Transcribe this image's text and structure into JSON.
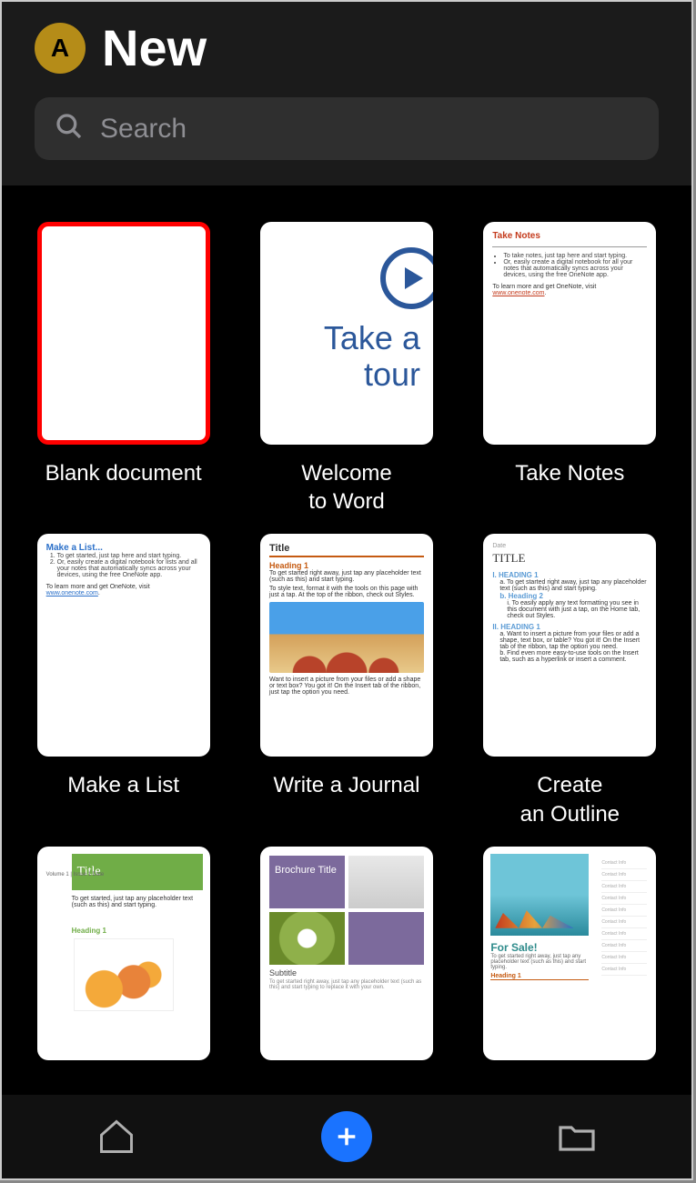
{
  "header": {
    "avatar_letter": "A",
    "title": "New"
  },
  "search": {
    "placeholder": "Search"
  },
  "templates": [
    {
      "label": "Blank document",
      "selected": true,
      "kind": "blank"
    },
    {
      "label": "Welcome\nto Word",
      "kind": "welcome",
      "tour_text": "Take a tour"
    },
    {
      "label": "Take Notes",
      "kind": "notes",
      "h": "Take Notes",
      "body_a": "To take notes, just tap here and start typing.",
      "body_b": "Or, easily create a digital notebook for all your notes that automatically syncs across your devices, using the free OneNote app.",
      "foot": "To learn more and get OneNote, visit ",
      "link": "www.onenote.com"
    },
    {
      "label": "Make a List",
      "kind": "list",
      "h": "Make a List...",
      "item1": "To get started, just tap here and start typing.",
      "item2": "Or, easily create a digital notebook for lists and all your notes that automatically syncs across your devices, using the free OneNote app.",
      "foot": "To learn more and get OneNote, visit ",
      "link": "www.onenote.com"
    },
    {
      "label": "Write a Journal",
      "kind": "journal",
      "title": "Title",
      "h1": "Heading 1",
      "lede": "To get started right away, just tap any placeholder text (such as this) and start typing.",
      "sub": "To style text, format it with the tools on this page with just a tap. At the top of the ribbon, check out Styles.",
      "cap": "Want to insert a picture from your files or add a shape or text box? You got it! On the Insert tab of the ribbon, just tap the option you need."
    },
    {
      "label": "Create\nan Outline",
      "kind": "outline",
      "date": "Date",
      "title": "TITLE",
      "s1": "HEADING 1",
      "s1a": "To get started right away, just tap any placeholder text (such as this) and start typing.",
      "s1b": "Heading 2",
      "s1c": "To easily apply any text formatting you see in this document with just a tap, on the Home tab, check out Styles.",
      "s2": "HEADING 1",
      "s2a": "Want to insert a picture from your files or add a shape, text box, or table? You got it! On the Insert tab of the ribbon, tap the option you need.",
      "s2b": "Find even more easy-to-use tools on the Insert tab, such as a hyperlink or insert a comment."
    },
    {
      "label": "",
      "kind": "news",
      "title": "Title",
      "vol": "Volume 1 | Issue 1\nDate",
      "lede": "To get started, just tap any placeholder text (such as this) and start typing.",
      "h1": "Heading 1"
    },
    {
      "label": "",
      "kind": "broch",
      "title": "Brochure\nTitle",
      "sub": "Subtitle",
      "cap": "To get started right away, just tap any placeholder text (such as this) and start typing to replace it with your own."
    },
    {
      "label": "",
      "kind": "flyer",
      "side": [
        "Contact Info",
        "Contact Info",
        "Contact Info",
        "Contact Info",
        "Contact Info",
        "Contact Info",
        "Contact Info",
        "Contact Info",
        "Contact Info",
        "Contact Info"
      ],
      "h": "For Sale!",
      "txt": "To get started right away, just tap any placeholder text (such as this) and start typing.",
      "h2": "Heading 1"
    }
  ],
  "toolbar": {
    "home": "home-icon",
    "add": "plus-icon",
    "folder": "folder-icon"
  }
}
